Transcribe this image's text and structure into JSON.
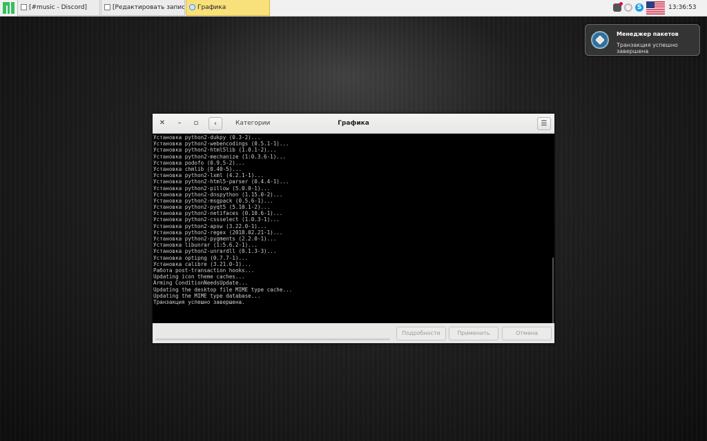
{
  "taskbar": {
    "tasks": [
      {
        "label": "[#music - Discord]"
      },
      {
        "label": "[Редактировать запись ‹ Los..."
      },
      {
        "label": "Графика"
      }
    ],
    "skype_glyph": "S",
    "clock": "13:36:53"
  },
  "notification": {
    "title": "Менеджер пакетов",
    "body": "Транзакция успешно завершена"
  },
  "window": {
    "close_glyph": "✕",
    "min_glyph": "–",
    "max_glyph": "▫",
    "back_glyph": "‹",
    "menu_glyph": "☰",
    "breadcrumb": "Категории",
    "title": "Графика",
    "log": [
      "Установка python2-dukpy (0.3-2)...",
      "Установка python2-webencodings (0.5.1-1)...",
      "Установка python2-html5lib (1.0.1-2)...",
      "Установка python2-mechanize (1:0.3.6-1)...",
      "Установка podofo (0.9.5-2)...",
      "Установка chmlib (0.40-5)...",
      "Установка python2-lxml (4.2.1-1)...",
      "Установка python2-html5-parser (0.4.4-1)...",
      "Установка python2-pillow (5.0.0-1)...",
      "Установка python2-dnspython (1.15.0-2)...",
      "Установка python2-msgpack (0.5.6-1)...",
      "Установка python2-pyqt5 (5.10.1-2)...",
      "Установка python2-netifaces (0.10.6-1)...",
      "Установка python2-cssselect (1.0.3-1)...",
      "Установка python2-apsw (3.22.0-1)...",
      "Установка python2-regex (2018.02.21-1)...",
      "Установка python2-pygments (2.2.0-1)...",
      "Установка libunrar (1:5.6.2-1)...",
      "Установка python2-unrardll (0.1.3-3)...",
      "Установка optipng (0.7.7-1)...",
      "Установка calibre (3.21.0-1)...",
      "Работа post-transaction hooks...",
      "Updating icon theme caches...",
      "Arming ConditionNeedsUpdate...",
      "Updating the desktop file MIME type cache...",
      "Updating the MIME type database...",
      "Транзакция успешно завершена."
    ],
    "buttons": {
      "details": "Подробности",
      "apply": "Применить",
      "cancel": "Отмена"
    }
  }
}
